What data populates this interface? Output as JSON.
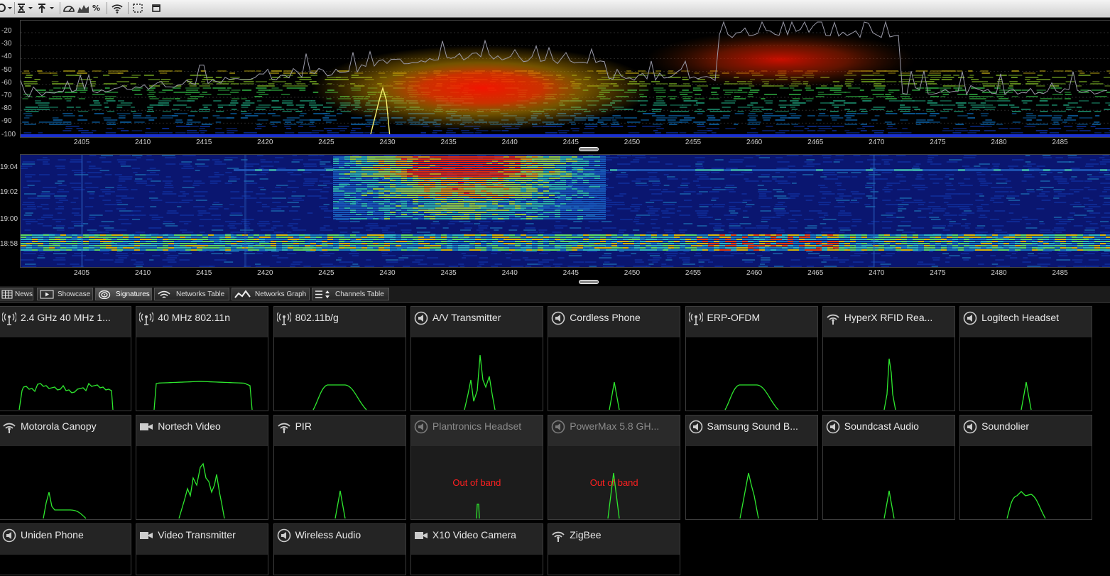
{
  "toolbar": {
    "percent_label": "%"
  },
  "spectrum": {
    "y_labels": [
      "-20",
      "-30",
      "-40",
      "-50",
      "-60",
      "-70",
      "-80",
      "-90",
      "-100"
    ],
    "x_labels": [
      "2405",
      "2410",
      "2415",
      "2420",
      "2425",
      "2430",
      "2435",
      "2440",
      "2445",
      "2450",
      "2455",
      "2460",
      "2465",
      "2470",
      "2475",
      "2480",
      "2485"
    ]
  },
  "waterfall": {
    "y_labels": [
      "19:04",
      "19:02",
      "19:00",
      "18:58"
    ],
    "x_labels": [
      "2405",
      "2410",
      "2415",
      "2420",
      "2425",
      "2430",
      "2435",
      "2440",
      "2445",
      "2450",
      "2455",
      "2460",
      "2465",
      "2470",
      "2475",
      "2480",
      "2485"
    ]
  },
  "tabs": [
    {
      "label": "News",
      "icon": "table-icon"
    },
    {
      "label": "Showcase",
      "icon": "play-icon"
    },
    {
      "label": "Signatures",
      "icon": "signature-icon",
      "active": true
    },
    {
      "label": "Networks Table",
      "icon": "wifi-icon"
    },
    {
      "label": "Networks Graph",
      "icon": "graph-icon"
    },
    {
      "label": "Channels Table",
      "icon": "channels-icon"
    }
  ],
  "signatures": [
    {
      "title": "2.4 GHz 40 MHz 1...",
      "icon": "antenna-icon",
      "shape": "wide-noisy"
    },
    {
      "title": "40 MHz 802.11n",
      "icon": "antenna-icon",
      "shape": "wide-flat"
    },
    {
      "title": "802.11b/g",
      "icon": "antenna-icon",
      "shape": "medium-flat"
    },
    {
      "title": "A/V Transmitter",
      "icon": "speaker-icon",
      "shape": "triple-peak"
    },
    {
      "title": "Cordless Phone",
      "icon": "speaker-icon",
      "shape": "single-small"
    },
    {
      "title": "ERP-OFDM",
      "icon": "antenna-icon",
      "shape": "medium-flat"
    },
    {
      "title": "HyperX RFID Rea...",
      "icon": "wifi-icon",
      "shape": "single-tall"
    },
    {
      "title": "Logitech Headset",
      "icon": "speaker-icon",
      "shape": "single-small"
    },
    {
      "title": "Motorola Canopy",
      "icon": "wifi-icon",
      "shape": "skewed-step"
    },
    {
      "title": "Nortech Video",
      "icon": "camera-icon",
      "shape": "jagged-hill"
    },
    {
      "title": "PIR",
      "icon": "wifi-icon",
      "shape": "single-small"
    },
    {
      "title": "Plantronics Headset",
      "icon": "speaker-icon",
      "shape": "oob-small",
      "dim": true,
      "note": "Out of band"
    },
    {
      "title": "PowerMax 5.8 GH...",
      "icon": "speaker-icon",
      "shape": "oob-tall",
      "dim": true,
      "note": "Out of band"
    },
    {
      "title": "Samsung Sound B...",
      "icon": "speaker-icon",
      "shape": "single-wide"
    },
    {
      "title": "Soundcast Audio",
      "icon": "speaker-icon",
      "shape": "single-small"
    },
    {
      "title": "Soundolier",
      "icon": "speaker-icon",
      "shape": "rounded-hump"
    },
    {
      "title": "Uniden Phone",
      "icon": "speaker-icon",
      "shape": "none"
    },
    {
      "title": "Video Transmitter",
      "icon": "camera-icon",
      "shape": "none"
    },
    {
      "title": "Wireless Audio",
      "icon": "speaker-icon",
      "shape": "none"
    },
    {
      "title": "X10 Video Camera",
      "icon": "camera-icon",
      "shape": "none"
    },
    {
      "title": "ZigBee",
      "icon": "wifi-icon",
      "shape": "none"
    }
  ]
}
